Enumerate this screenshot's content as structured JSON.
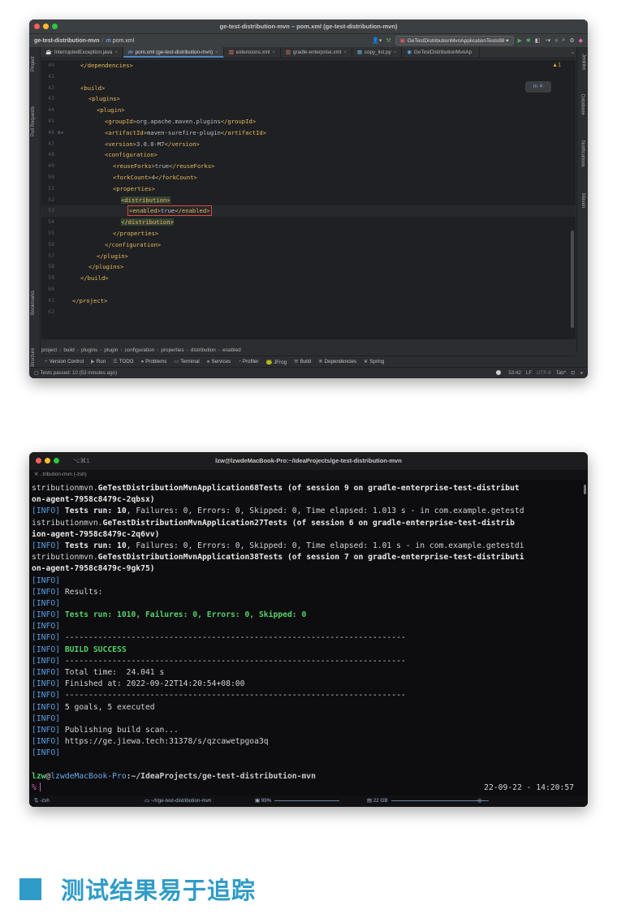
{
  "ide": {
    "window_title": "ge-test-distribution-mvn – pom.xml (ge-test-distribution-mvn)",
    "nav_project": "ge-test-distribution-mvn",
    "nav_file": "pom.xml",
    "run_config": "GeTestDistributionMvnApplicationTests98",
    "tabs": [
      {
        "label": "InterruptedException.java",
        "icon": "java-icon"
      },
      {
        "label": "pom.xml (ge-test-distribution-mvn)",
        "icon": "maven-icon",
        "active": true
      },
      {
        "label": "extensions.xml",
        "icon": "xml-icon"
      },
      {
        "label": "gradle-enterprise.xml",
        "icon": "xml-icon"
      },
      {
        "label": "copy_list.py",
        "icon": "python-icon"
      },
      {
        "label": "GeTestDistributionMvnAp",
        "icon": "kotlin-icon"
      }
    ],
    "left_tools": [
      "Project",
      "Pull Requests",
      "Bookmarks",
      "Structure"
    ],
    "right_tools": [
      "Jenkins",
      "Database",
      "Notifications",
      "Maven"
    ],
    "warning_count": "▲1",
    "code_lines": [
      {
        "n": "40",
        "indent": 2,
        "text": "</dependencies>"
      },
      {
        "n": "41",
        "indent": 0,
        "text": ""
      },
      {
        "n": "42",
        "indent": 2,
        "text": "<build>"
      },
      {
        "n": "43",
        "indent": 4,
        "text": "<plugins>"
      },
      {
        "n": "44",
        "indent": 6,
        "text": "<plugin>"
      },
      {
        "n": "45",
        "indent": 8,
        "text": "<groupId>org.apache.maven.plugins</groupId>"
      },
      {
        "n": "46",
        "indent": 8,
        "text": "<artifactId>maven-surefire-plugin</artifactId>"
      },
      {
        "n": "47",
        "indent": 8,
        "text": "<version>3.0.0-M7</version>"
      },
      {
        "n": "48",
        "indent": 8,
        "text": "<configuration>"
      },
      {
        "n": "49",
        "indent": 10,
        "text": "<reuseForks>true</reuseForks>"
      },
      {
        "n": "50",
        "indent": 10,
        "text": "<forkCount>4</forkCount>"
      },
      {
        "n": "51",
        "indent": 10,
        "text": "<properties>"
      },
      {
        "n": "52",
        "indent": 12,
        "text": "<distribution>"
      },
      {
        "n": "53",
        "indent": 14,
        "text": "<enabled>true</enabled>"
      },
      {
        "n": "54",
        "indent": 12,
        "text": "</distribution>"
      },
      {
        "n": "55",
        "indent": 10,
        "text": "</properties>"
      },
      {
        "n": "56",
        "indent": 8,
        "text": "</configuration>"
      },
      {
        "n": "57",
        "indent": 6,
        "text": "</plugin>"
      },
      {
        "n": "58",
        "indent": 4,
        "text": "</plugins>"
      },
      {
        "n": "59",
        "indent": 2,
        "text": "</build>"
      },
      {
        "n": "60",
        "indent": 0,
        "text": ""
      },
      {
        "n": "61",
        "indent": 0,
        "text": "</project>"
      },
      {
        "n": "62",
        "indent": 0,
        "text": ""
      }
    ],
    "breadcrumb": [
      "project",
      "build",
      "plugins",
      "plugin",
      "configuration",
      "properties",
      "distribution",
      "enabled"
    ],
    "toolwindows": [
      "Version Control",
      "Run",
      "TODO",
      "Problems",
      "Terminal",
      "Services",
      "Profiler",
      "JFrog",
      "Build",
      "Dependencies",
      "Spring"
    ],
    "status_left": "Tests passed: 10 (53 minutes ago)",
    "status_right": [
      "53:42",
      "LF",
      "UTF-8",
      "Tab*"
    ]
  },
  "terminal": {
    "window_title": "lzw@lzwdeMacBook-Pro:~/IdeaProjects/ge-test-distribution-mvn",
    "shortcut": "⌥⌘1",
    "tab_label": "..tribution-mvn (-zsh)",
    "lines": [
      [
        {
          "c": "",
          "t": "stributionmvn."
        },
        {
          "c": "b",
          "t": "GeTestDistributionMvnApplication68Tests"
        },
        {
          "c": "b",
          "t": " (of session 9 on gradle-enterprise-test-distribut"
        }
      ],
      [
        {
          "c": "b",
          "t": "on-agent-7958c8479c-2qbsx)"
        }
      ],
      [
        {
          "c": "i",
          "t": "[INFO] "
        },
        {
          "c": "b",
          "t": "Tests run: 10"
        },
        {
          "c": "",
          "t": ", Failures: 0, Errors: 0, Skipped: 0, Time elapsed: 1.013 s - in com.example.getestd"
        }
      ],
      [
        {
          "c": "",
          "t": "istributionmvn."
        },
        {
          "c": "b",
          "t": "GeTestDistributionMvnApplication27Tests"
        },
        {
          "c": "b",
          "t": " (of session 6 on gradle-enterprise-test-distrib"
        }
      ],
      [
        {
          "c": "b",
          "t": "ion-agent-7958c8479c-2q6vv)"
        }
      ],
      [
        {
          "c": "i",
          "t": "[INFO] "
        },
        {
          "c": "b",
          "t": "Tests run: 10"
        },
        {
          "c": "",
          "t": ", Failures: 0, Errors: 0, Skipped: 0, Time elapsed: 1.01 s - in com.example.getestdi"
        }
      ],
      [
        {
          "c": "",
          "t": "stributionmvn."
        },
        {
          "c": "b",
          "t": "GeTestDistributionMvnApplication38Tests"
        },
        {
          "c": "b",
          "t": " (of session 7 on gradle-enterprise-test-distributi"
        }
      ],
      [
        {
          "c": "b",
          "t": "on-agent-7958c8479c-9gk75)"
        }
      ],
      [
        {
          "c": "i",
          "t": "[INFO]"
        }
      ],
      [
        {
          "c": "i",
          "t": "[INFO] "
        },
        {
          "c": "",
          "t": "Results:"
        }
      ],
      [
        {
          "c": "i",
          "t": "[INFO]"
        }
      ],
      [
        {
          "c": "i",
          "t": "[INFO] "
        },
        {
          "c": "g",
          "t": "Tests run: 1010, Failures: 0, Errors: 0, Skipped: 0"
        }
      ],
      [
        {
          "c": "i",
          "t": "[INFO]"
        }
      ],
      [
        {
          "c": "i",
          "t": "[INFO] "
        },
        {
          "c": "",
          "t": "------------------------------------------------------------------------"
        }
      ],
      [
        {
          "c": "i",
          "t": "[INFO] "
        },
        {
          "c": "g",
          "t": "BUILD SUCCESS"
        }
      ],
      [
        {
          "c": "i",
          "t": "[INFO] "
        },
        {
          "c": "",
          "t": "------------------------------------------------------------------------"
        }
      ],
      [
        {
          "c": "i",
          "t": "[INFO] "
        },
        {
          "c": "",
          "t": "Total time:  24.041 s"
        }
      ],
      [
        {
          "c": "i",
          "t": "[INFO] "
        },
        {
          "c": "",
          "t": "Finished at: 2022-09-22T14:20:54+08:00"
        }
      ],
      [
        {
          "c": "i",
          "t": "[INFO] "
        },
        {
          "c": "",
          "t": "------------------------------------------------------------------------"
        }
      ],
      [
        {
          "c": "i",
          "t": "[INFO] "
        },
        {
          "c": "",
          "t": "5 goals, 5 executed"
        }
      ],
      [
        {
          "c": "i",
          "t": "[INFO]"
        }
      ],
      [
        {
          "c": "i",
          "t": "[INFO] "
        },
        {
          "c": "",
          "t": "Publishing build scan..."
        }
      ],
      [
        {
          "c": "i",
          "t": "[INFO] "
        },
        {
          "c": "",
          "t": "https://ge.jiewa.tech:31378/s/qzcawetpgoa3q"
        }
      ],
      [
        {
          "c": "i",
          "t": "[INFO]"
        }
      ],
      [
        {
          "c": "",
          "t": ""
        }
      ]
    ],
    "prompt_user": "lzw",
    "prompt_at": "@",
    "prompt_host": "lzwdeMacBook-Pro",
    "prompt_path": ":~/IdeaProjects/ge-test-distribution-mvn",
    "prompt_symbol": "%",
    "prompt_time": "22-09-22 - 14:20:57",
    "status_shell": "-zsh",
    "status_dir": "~/I/ge-test-distribution-mvn",
    "status_cpu": "99%",
    "status_mem": "22 GB"
  },
  "heading": {
    "text": "测试结果易于追踪",
    "color": "#2f9bc7"
  }
}
